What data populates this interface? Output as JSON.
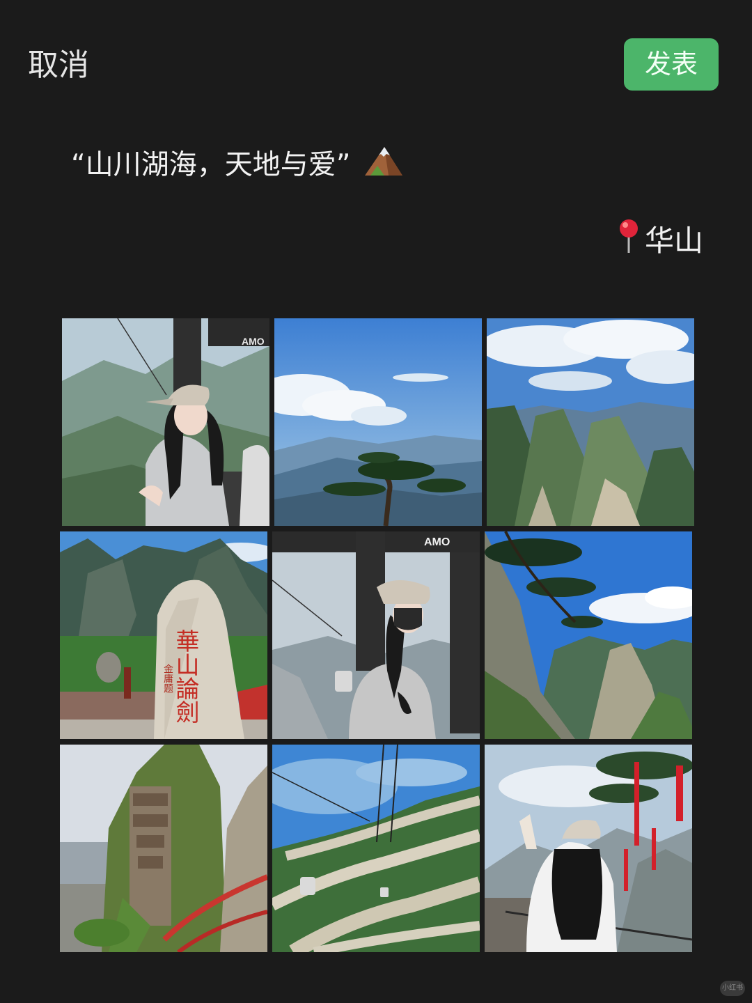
{
  "header": {
    "cancel_label": "取消",
    "publish_label": "发表",
    "publish_color": "#4cb56a"
  },
  "post": {
    "caption": "“山川湖海，天地与爱”",
    "caption_icon": "snow-capped-mountain-icon",
    "location_icon": "map-pin-icon",
    "location": "华山"
  },
  "photos": [
    {
      "name": "photo-girl-in-cable-car-cap"
    },
    {
      "name": "photo-pine-tree-sky"
    },
    {
      "name": "photo-mountain-peaks-clouds"
    },
    {
      "name": "photo-huashan-lunjian-stone"
    },
    {
      "name": "photo-girl-masked-cable-car"
    },
    {
      "name": "photo-pine-cliff-peaks"
    },
    {
      "name": "photo-cliff-temple"
    },
    {
      "name": "photo-cable-car-over-ridges"
    },
    {
      "name": "photo-girl-back-red-ribbons"
    }
  ],
  "tile_text": {
    "cable_car_brand": "AMO",
    "stone_inscription": "華山論劍",
    "stone_signature": "金庸题"
  },
  "watermark": "小红书"
}
